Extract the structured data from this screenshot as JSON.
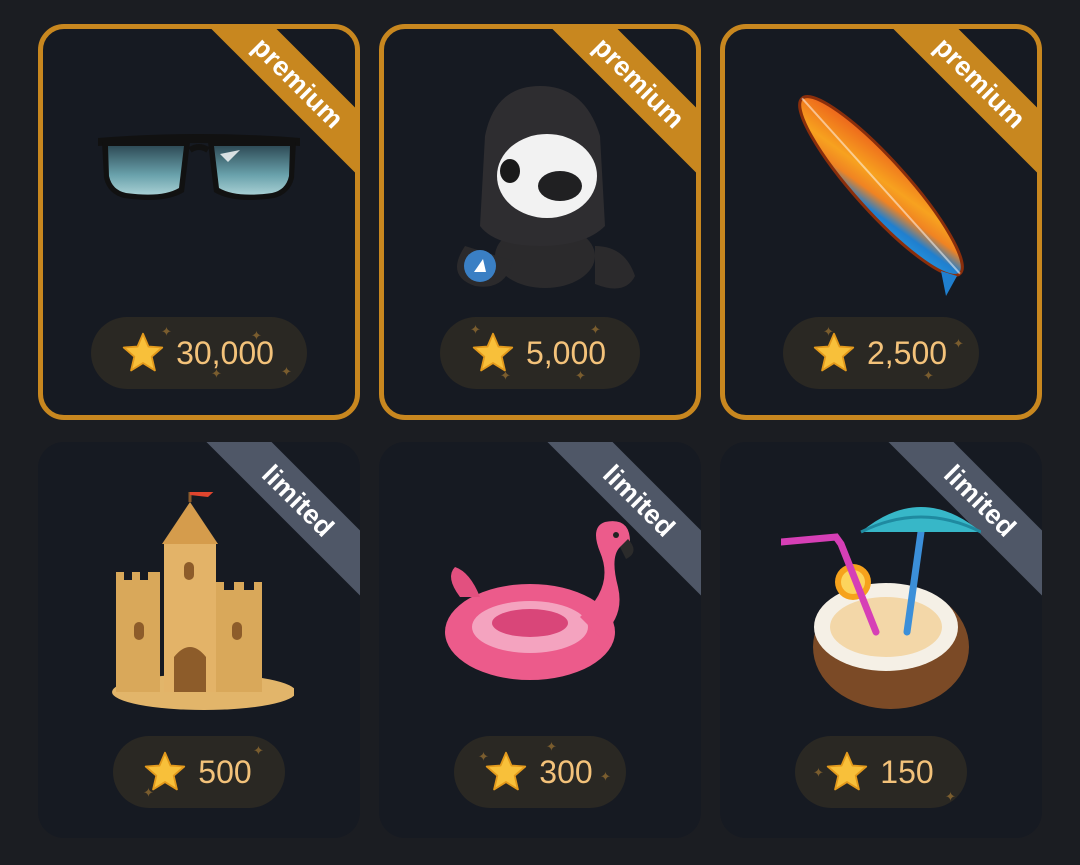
{
  "gifts": [
    {
      "badge": "premium",
      "price": "30,000",
      "icon": "sunglasses-icon"
    },
    {
      "badge": "premium",
      "price": "5,000",
      "icon": "hooded-bear-plush-icon"
    },
    {
      "badge": "premium",
      "price": "2,500",
      "icon": "surfboard-icon"
    },
    {
      "badge": "limited",
      "price": "500",
      "icon": "sandcastle-icon"
    },
    {
      "badge": "limited",
      "price": "300",
      "icon": "flamingo-float-icon"
    },
    {
      "badge": "limited",
      "price": "150",
      "icon": "coconut-cocktail-icon"
    }
  ],
  "colors": {
    "premium_accent": "#c8871f",
    "limited_ribbon": "#4f5767",
    "card_bg": "#161a22",
    "price_text": "#f3c27a"
  },
  "price_icon": "star-icon"
}
